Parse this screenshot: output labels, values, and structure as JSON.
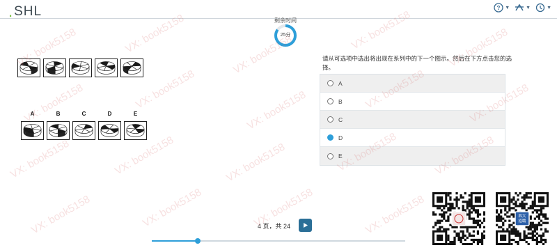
{
  "header": {
    "logo": "SHL",
    "help_icon": "help-circle-icon",
    "accessibility_icon": "accessibility-icon",
    "settings_icon": "settings-icon"
  },
  "timer": {
    "label": "剩余时间",
    "value": "25分",
    "remaining_fraction": 0.85,
    "color": "#2e9fd9"
  },
  "question": {
    "text": "请从可选项中选出将出现在系列中的下一个图示。然后在下方点击您的选择。",
    "series_figure_count": 5,
    "option_letters": [
      "A",
      "B",
      "C",
      "D",
      "E"
    ]
  },
  "choices": [
    {
      "label": "A",
      "selected": false
    },
    {
      "label": "B",
      "selected": false
    },
    {
      "label": "C",
      "selected": false
    },
    {
      "label": "D",
      "selected": true
    },
    {
      "label": "E",
      "selected": false
    }
  ],
  "qr_codes": {
    "left_caption": "",
    "right_caption": "四大\n招聘"
  },
  "pagination": {
    "text": "4 页，共 24",
    "next_icon": "play-icon",
    "progress_fraction": 0.18
  },
  "watermark": "VX: book5158",
  "colors": {
    "accent": "#2e9fd9",
    "button": "#2b6f97",
    "logo_dot": "#7bc043"
  }
}
